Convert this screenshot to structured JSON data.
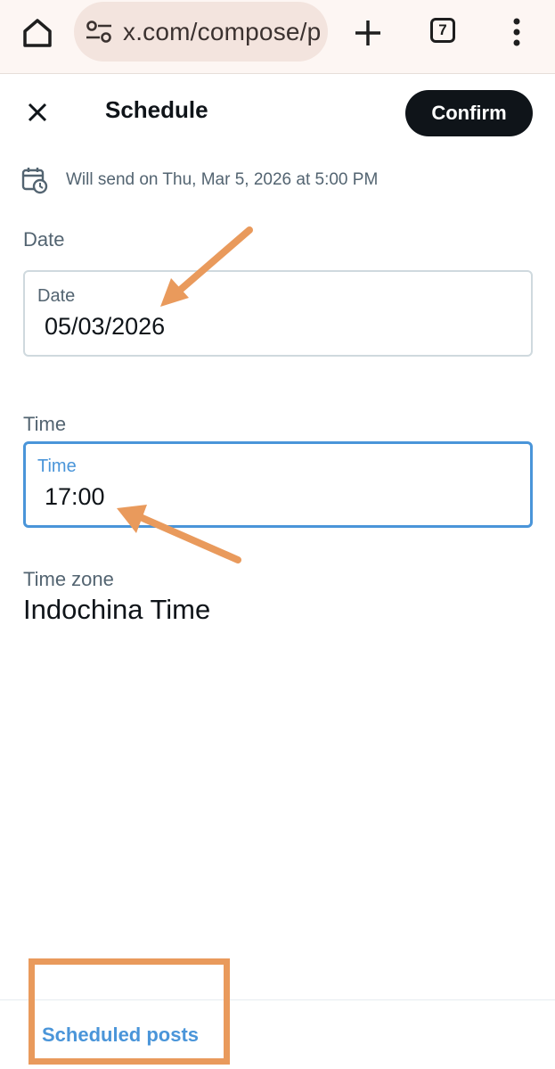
{
  "browser": {
    "url": "x.com/compose/p",
    "tab_count": "7",
    "icons": [
      "home-icon",
      "site-settings-icon",
      "plus-icon",
      "tabs-icon",
      "more-vert-icon"
    ]
  },
  "header": {
    "title": "Schedule",
    "confirm_label": "Confirm",
    "close_icon": "close-icon"
  },
  "info": {
    "icon": "calendar-clock-icon",
    "text": "Will send on Thu, Mar 5, 2026 at 5:00 PM"
  },
  "date": {
    "section_label": "Date",
    "field_label": "Date",
    "value": "05/03/2026"
  },
  "time": {
    "section_label": "Time",
    "field_label": "Time",
    "value": "17:00"
  },
  "timezone": {
    "label": "Time zone",
    "value": "Indochina Time"
  },
  "footer": {
    "link_label": "Scheduled posts"
  },
  "colors": {
    "accent": "#4a95d9",
    "annotation": "#e99a5c",
    "button_dark": "#0f1419",
    "secondary_text": "#536471"
  }
}
